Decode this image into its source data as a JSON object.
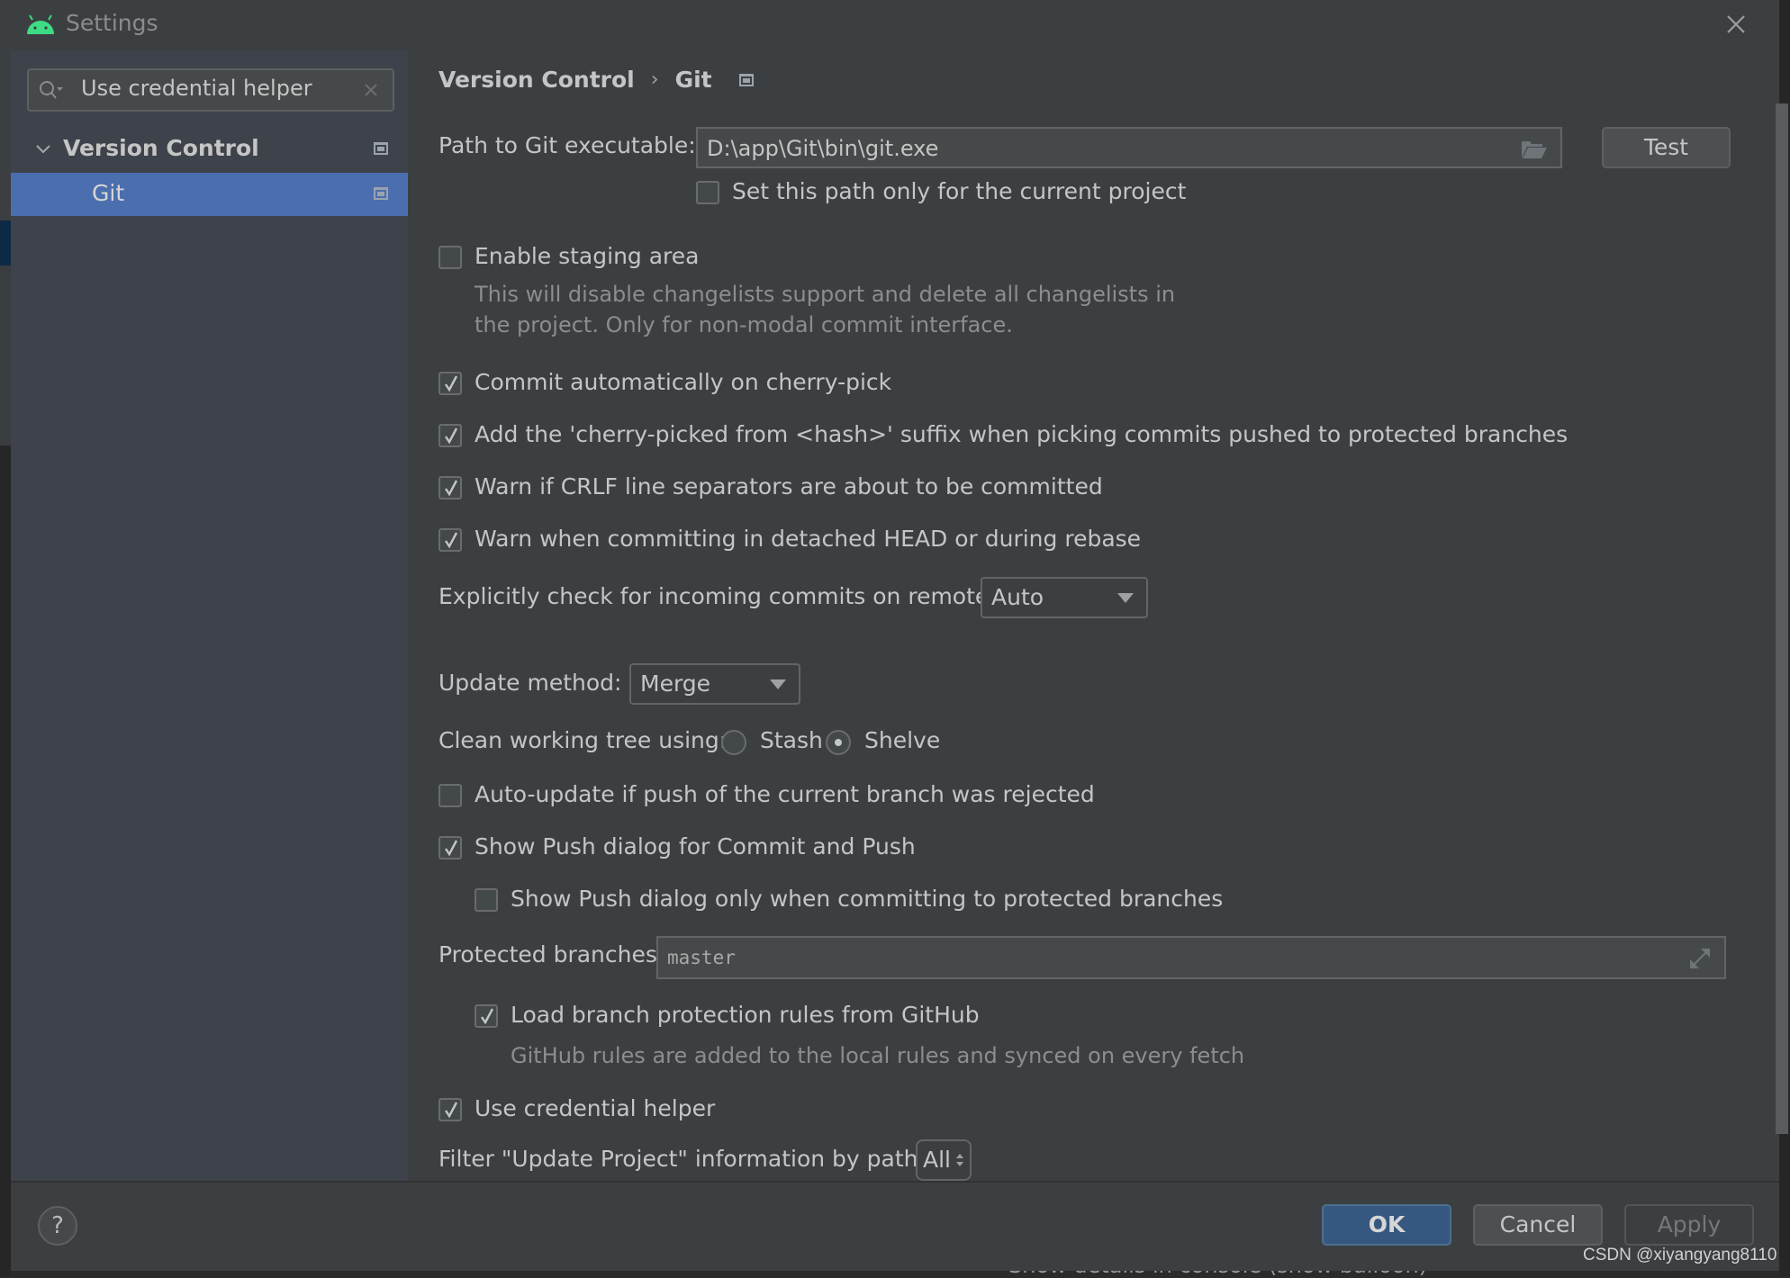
{
  "window": {
    "title": "Settings",
    "app_icon": "android-icon",
    "close_icon": "close-icon"
  },
  "sidebar": {
    "search": {
      "value": "Use credential helper",
      "placeholder": ""
    },
    "tree": [
      {
        "label": "Version Control",
        "expanded": true,
        "bold": true,
        "selected": false,
        "icon": "project-settings-icon"
      },
      {
        "label": "Git",
        "selected": true,
        "icon": "project-settings-icon"
      }
    ]
  },
  "breadcrumb": {
    "items": [
      "Version Control",
      "Git"
    ],
    "separator": "›"
  },
  "git": {
    "path_label": "Path to Git executable:",
    "path_value": "D:\\app\\Git\\bin\\git.exe",
    "test_button": "Test",
    "set_path_current_project": {
      "label": "Set this path only for the current project",
      "checked": false
    },
    "enable_staging": {
      "label": "Enable staging area",
      "checked": false
    },
    "staging_hint_line1": "This will disable changelists support and delete all changelists in",
    "staging_hint_line2": "the project. Only for non-modal commit interface.",
    "commit_cherry_pick": {
      "label": "Commit automatically on cherry-pick",
      "checked": true
    },
    "cherry_pick_suffix": {
      "label": "Add the 'cherry-picked from <hash>' suffix when picking commits pushed to protected branches",
      "checked": true
    },
    "warn_crlf": {
      "label": "Warn if CRLF line separators are about to be committed",
      "checked": true
    },
    "warn_detached": {
      "label": "Warn when committing in detached HEAD or during rebase",
      "checked": true
    },
    "incoming_label": "Explicitly check for incoming commits on remotes:",
    "incoming_value": "Auto",
    "update_method_label": "Update method:",
    "update_method_value": "Merge",
    "clean_tree_label": "Clean working tree using:",
    "clean_options": [
      {
        "label": "Stash",
        "selected": false
      },
      {
        "label": "Shelve",
        "selected": true
      }
    ],
    "auto_update": {
      "label": "Auto-update if push of the current branch was rejected",
      "checked": false
    },
    "show_push_dialog": {
      "label": "Show Push dialog for Commit and Push",
      "checked": true
    },
    "show_push_protected": {
      "label": "Show Push dialog only when committing to protected branches",
      "checked": false
    },
    "protected_label": "Protected branches:",
    "protected_value": "master",
    "load_github_rules": {
      "label": "Load branch protection rules from GitHub",
      "checked": true
    },
    "github_hint": "GitHub rules are added to the local rules and synced on every fetch",
    "credential_helper": {
      "label": "Use credential helper",
      "checked": true
    },
    "filter_label": "Filter \"Update Project\" information by paths:",
    "filter_value": "All"
  },
  "footer": {
    "help": "?",
    "ok": "OK",
    "cancel": "Cancel",
    "apply": "Apply"
  },
  "background": {
    "bottom_text": "Show details in console (show balloon)",
    "watermark": "CSDN @xiyangyang8110"
  },
  "colors": {
    "selection": "#4b6eaf",
    "primary_button": "#365880",
    "dialog_bg": "#3c3f41",
    "sidebar_bg": "#3e424a",
    "android_green": "#3ddc84"
  }
}
